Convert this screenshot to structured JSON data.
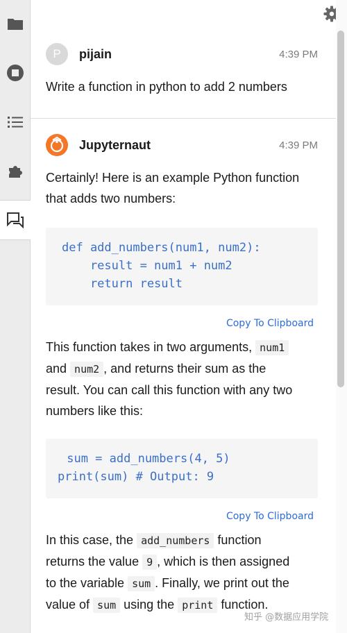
{
  "sidebar": {
    "items": [
      {
        "icon": "folder-icon"
      },
      {
        "icon": "stop-circle-icon"
      },
      {
        "icon": "list-icon"
      },
      {
        "icon": "puzzle-icon"
      },
      {
        "icon": "chat-icon",
        "active": true
      }
    ]
  },
  "toolbar": {
    "settings_icon": "gear-icon"
  },
  "messages": [
    {
      "avatar_letter": "P",
      "author": "pijain",
      "time": "4:39 PM",
      "text": "Write a function in python to add 2 numbers"
    },
    {
      "author": "Jupyternaut",
      "time": "4:39 PM",
      "intro_line1": "Certainly! Here is an example Python function",
      "intro_line2": "that adds two numbers:",
      "code1": {
        "line1": "def add_numbers(num1, num2):",
        "line2": "    result = num1 + num2",
        "line3": "    return result"
      },
      "copy_label_1": "Copy To Clipboard",
      "p2": {
        "l1_a": "This function takes in two arguments, ",
        "l1_code": "num1",
        "l2_a": "and ",
        "l2_code": "num2",
        "l2_b": ", and returns their sum as the",
        "l3": "result. You can call this function with any two",
        "l4": "numbers like this:"
      },
      "code2": {
        "line1": " sum = add_numbers(4, 5)",
        "line2": "print(sum) # Output: 9"
      },
      "copy_label_2": "Copy To Clipboard",
      "p3": {
        "l1_a": "In this case, the ",
        "l1_code": "add_numbers",
        "l1_b": " function",
        "l2_a": "returns the value ",
        "l2_code": "9",
        "l2_b": ", which is then assigned",
        "l3_a": "to the variable ",
        "l3_code": "sum",
        "l3_b": ". Finally, we print out the",
        "l4_a": "value of ",
        "l4_code": "sum",
        "l4_b": " using the ",
        "l4_code2": "print",
        "l4_c": " function."
      }
    }
  ],
  "watermark": "知乎 @数据应用学院",
  "colors": {
    "accent_orange": "#f37726",
    "code_blue": "#3b6fc7",
    "link_blue": "#2c6cd8"
  }
}
